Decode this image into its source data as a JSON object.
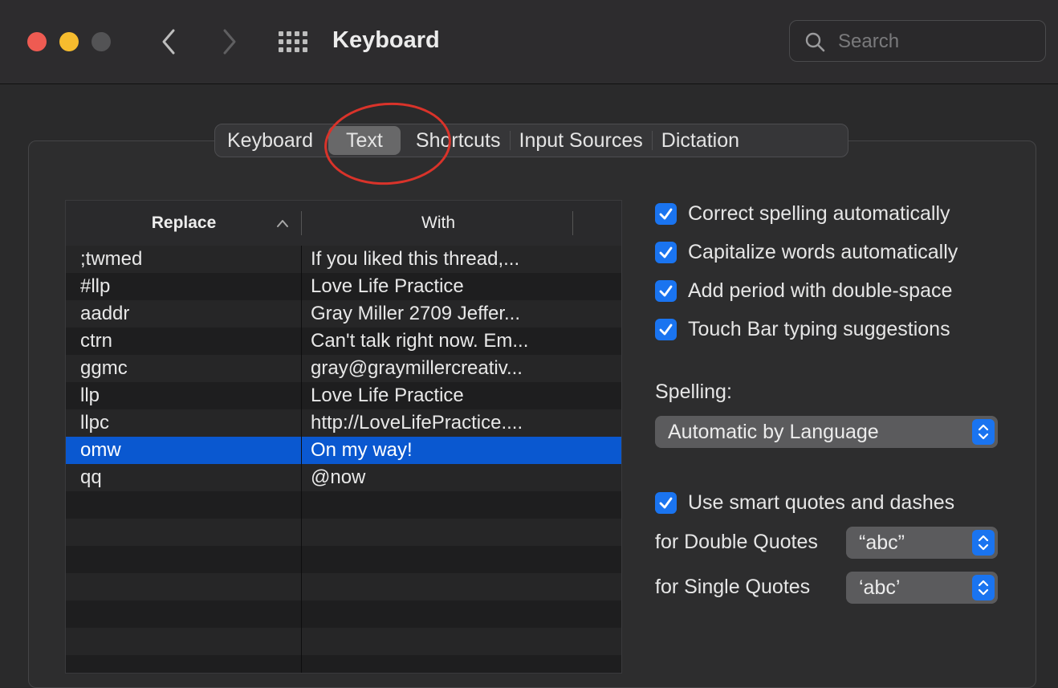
{
  "window": {
    "title": "Keyboard"
  },
  "search": {
    "placeholder": "Search"
  },
  "tabs": [
    {
      "label": "Keyboard",
      "selected": false
    },
    {
      "label": "Text",
      "selected": true
    },
    {
      "label": "Shortcuts",
      "selected": false
    },
    {
      "label": "Input Sources",
      "selected": false
    },
    {
      "label": "Dictation",
      "selected": false
    }
  ],
  "table": {
    "columns": {
      "replace": "Replace",
      "with": "With"
    },
    "rows": [
      {
        "replace": ";twmed",
        "with": "If you liked this thread,..."
      },
      {
        "replace": "#llp",
        "with": "Love Life Practice"
      },
      {
        "replace": "aaddr",
        "with": "Gray Miller 2709 Jeffer..."
      },
      {
        "replace": "ctrn",
        "with": "Can't talk right now. Em..."
      },
      {
        "replace": "ggmc",
        "with": "gray@graymillercreativ..."
      },
      {
        "replace": "llp",
        "with": "Love Life Practice"
      },
      {
        "replace": "llpc",
        "with": "http://LoveLifePractice...."
      },
      {
        "replace": "omw",
        "with": "On my way!",
        "selected": true
      },
      {
        "replace": "qq",
        "with": "@now"
      },
      {
        "replace": "",
        "with": ""
      },
      {
        "replace": "",
        "with": ""
      },
      {
        "replace": "",
        "with": ""
      },
      {
        "replace": "",
        "with": ""
      },
      {
        "replace": "",
        "with": ""
      },
      {
        "replace": "",
        "with": ""
      },
      {
        "replace": "",
        "with": ""
      }
    ]
  },
  "options": {
    "correct_spelling": "Correct spelling automatically",
    "capitalize_words": "Capitalize words automatically",
    "add_period": "Add period with double-space",
    "touch_bar": "Touch Bar typing suggestions",
    "spelling_label": "Spelling:",
    "spelling_value": "Automatic by Language",
    "smart_quotes": "Use smart quotes and dashes",
    "double_quotes_label": "for Double Quotes",
    "double_quotes_value": "“abc”",
    "single_quotes_label": "for Single Quotes",
    "single_quotes_value": "‘abc’"
  },
  "colors": {
    "accent": "#1a74f0",
    "selection": "#0a58d0",
    "annotation": "#d9332a"
  }
}
